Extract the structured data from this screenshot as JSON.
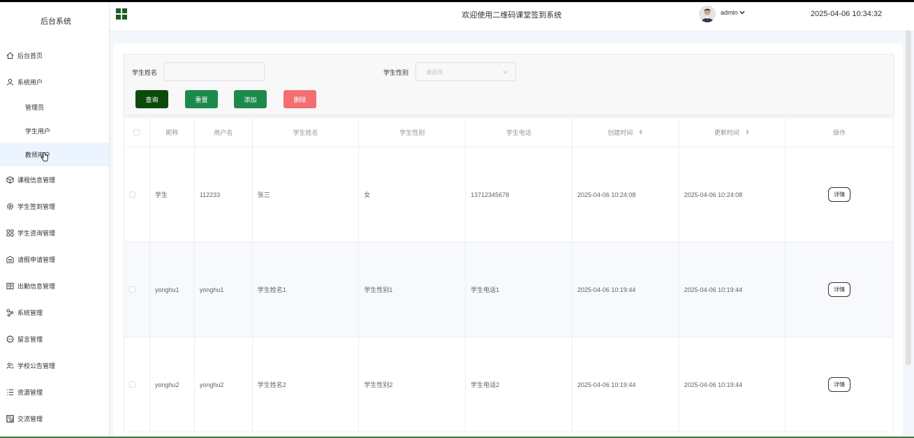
{
  "sidebar": {
    "brand": "后台系统",
    "items": [
      {
        "label": "后台首页",
        "icon": "home-icon"
      },
      {
        "label": "系统用户",
        "icon": "user-icon"
      },
      {
        "label": "课程信息管理",
        "icon": "cube-icon"
      },
      {
        "label": "学生签到管理",
        "icon": "gear-icon"
      },
      {
        "label": "学生咨询管理",
        "icon": "grid-icon"
      },
      {
        "label": "请假申请管理",
        "icon": "document-icon"
      },
      {
        "label": "出勤信息管理",
        "icon": "card-icon"
      },
      {
        "label": "系统管理",
        "icon": "share-icon"
      },
      {
        "label": "留言管理",
        "icon": "chat-icon"
      },
      {
        "label": "学校公告管理",
        "icon": "people-icon"
      },
      {
        "label": "资源管理",
        "icon": "list-icon"
      },
      {
        "label": "交流管理",
        "icon": "setting-doc-icon"
      }
    ],
    "sub_items": [
      {
        "label": "管理员"
      },
      {
        "label": "学生用户"
      },
      {
        "label": "教师用户"
      }
    ]
  },
  "header": {
    "welcome": "欢迎使用二维码课堂签到系统",
    "username": "admin",
    "datetime": "2025-04-06 10:34:32"
  },
  "search": {
    "name_label": "学生姓名",
    "name_value": "",
    "gender_label": "学生性别",
    "gender_placeholder": "请选择",
    "buttons": {
      "query": "查询",
      "reset": "重置",
      "add": "添加",
      "delete": "删除"
    }
  },
  "table": {
    "headers": [
      "",
      "昵称",
      "用户名",
      "学生姓名",
      "学生性别",
      "学生电话",
      "创建时间",
      "更新时间",
      "操作"
    ],
    "rows": [
      [
        "",
        "学生",
        "112233",
        "张三",
        "女",
        "13712345678",
        "2025-04-06 10:24:08",
        "2025-04-06 10:24:08",
        "详情"
      ],
      [
        "",
        "yonghu1",
        "yonghu1",
        "学生姓名1",
        "学生性别1",
        "学生电话1",
        "2025-04-06 10:19:44",
        "2025-04-06 10:19:44",
        "详情"
      ],
      [
        "",
        "yonghu2",
        "yonghu2",
        "学生姓名2",
        "学生性别2",
        "学生电话2",
        "2025-04-06 10:19:44",
        "2025-04-06 10:19:44",
        "详情"
      ]
    ]
  },
  "colors": {
    "query": "#0b4a0b",
    "reset": "#1d8a4c",
    "add": "#1d8a4c",
    "delete": "#f36f6f",
    "active_menu_bg": "#ecf5ff"
  }
}
